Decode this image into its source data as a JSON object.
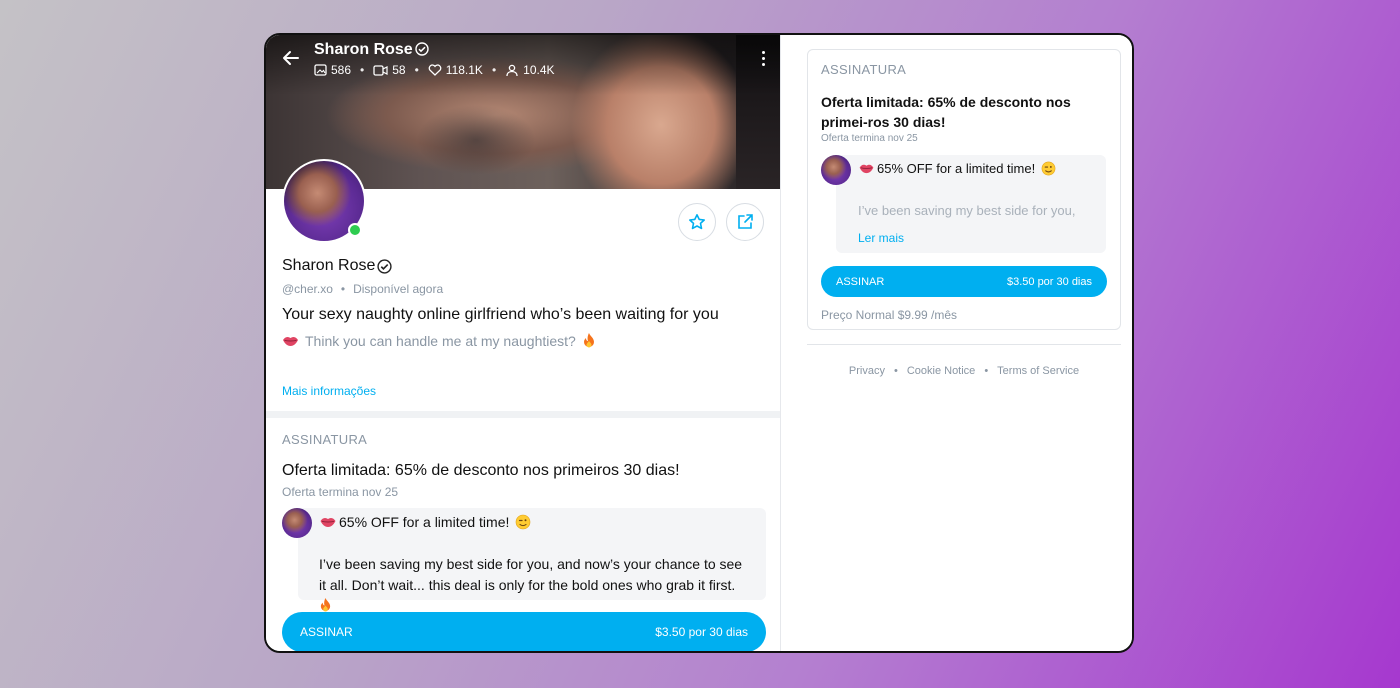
{
  "profile": {
    "name": "Sharon Rose",
    "stats": {
      "photos": "586",
      "videos": "58",
      "likes": "118.1K",
      "fans": "10.4K"
    },
    "handle": "@cher.xo",
    "status": "Disponível agora",
    "bio_title": "Your sexy naughty online girlfriend who’s been waiting for you",
    "bio_sub": "Think you can handle me at my naughtiest?",
    "more_info": "Mais informações"
  },
  "subscription": {
    "label": "ASSINATURA",
    "offer_title": "Oferta limitada: 65% de desconto nos primeiros 30 dias!",
    "offer_title_right": "Oferta limitada: 65% de desconto nos primei-ros 30 dias!",
    "offer_ends": "Oferta termina nov 25",
    "message_head": "65% OFF for a limited time!",
    "message_body": "I’ve been saving my best side for you, and now’s your chance to see it all. Don’t wait... this deal is only for the bold ones who grab it first.",
    "message_body_truncated": "I’ve been saving my best side for you,",
    "read_more": "Ler mais",
    "button_label": "ASSINAR",
    "button_price": "$3.50 por 30 dias",
    "regular_price": "Preço Normal $9.99 /mês"
  },
  "footer": {
    "privacy": "Privacy",
    "cookie": "Cookie Notice",
    "terms": "Terms of Service"
  },
  "colors": {
    "accent": "#00aff0",
    "online": "#2ecc50",
    "muted": "#8a96a3"
  }
}
